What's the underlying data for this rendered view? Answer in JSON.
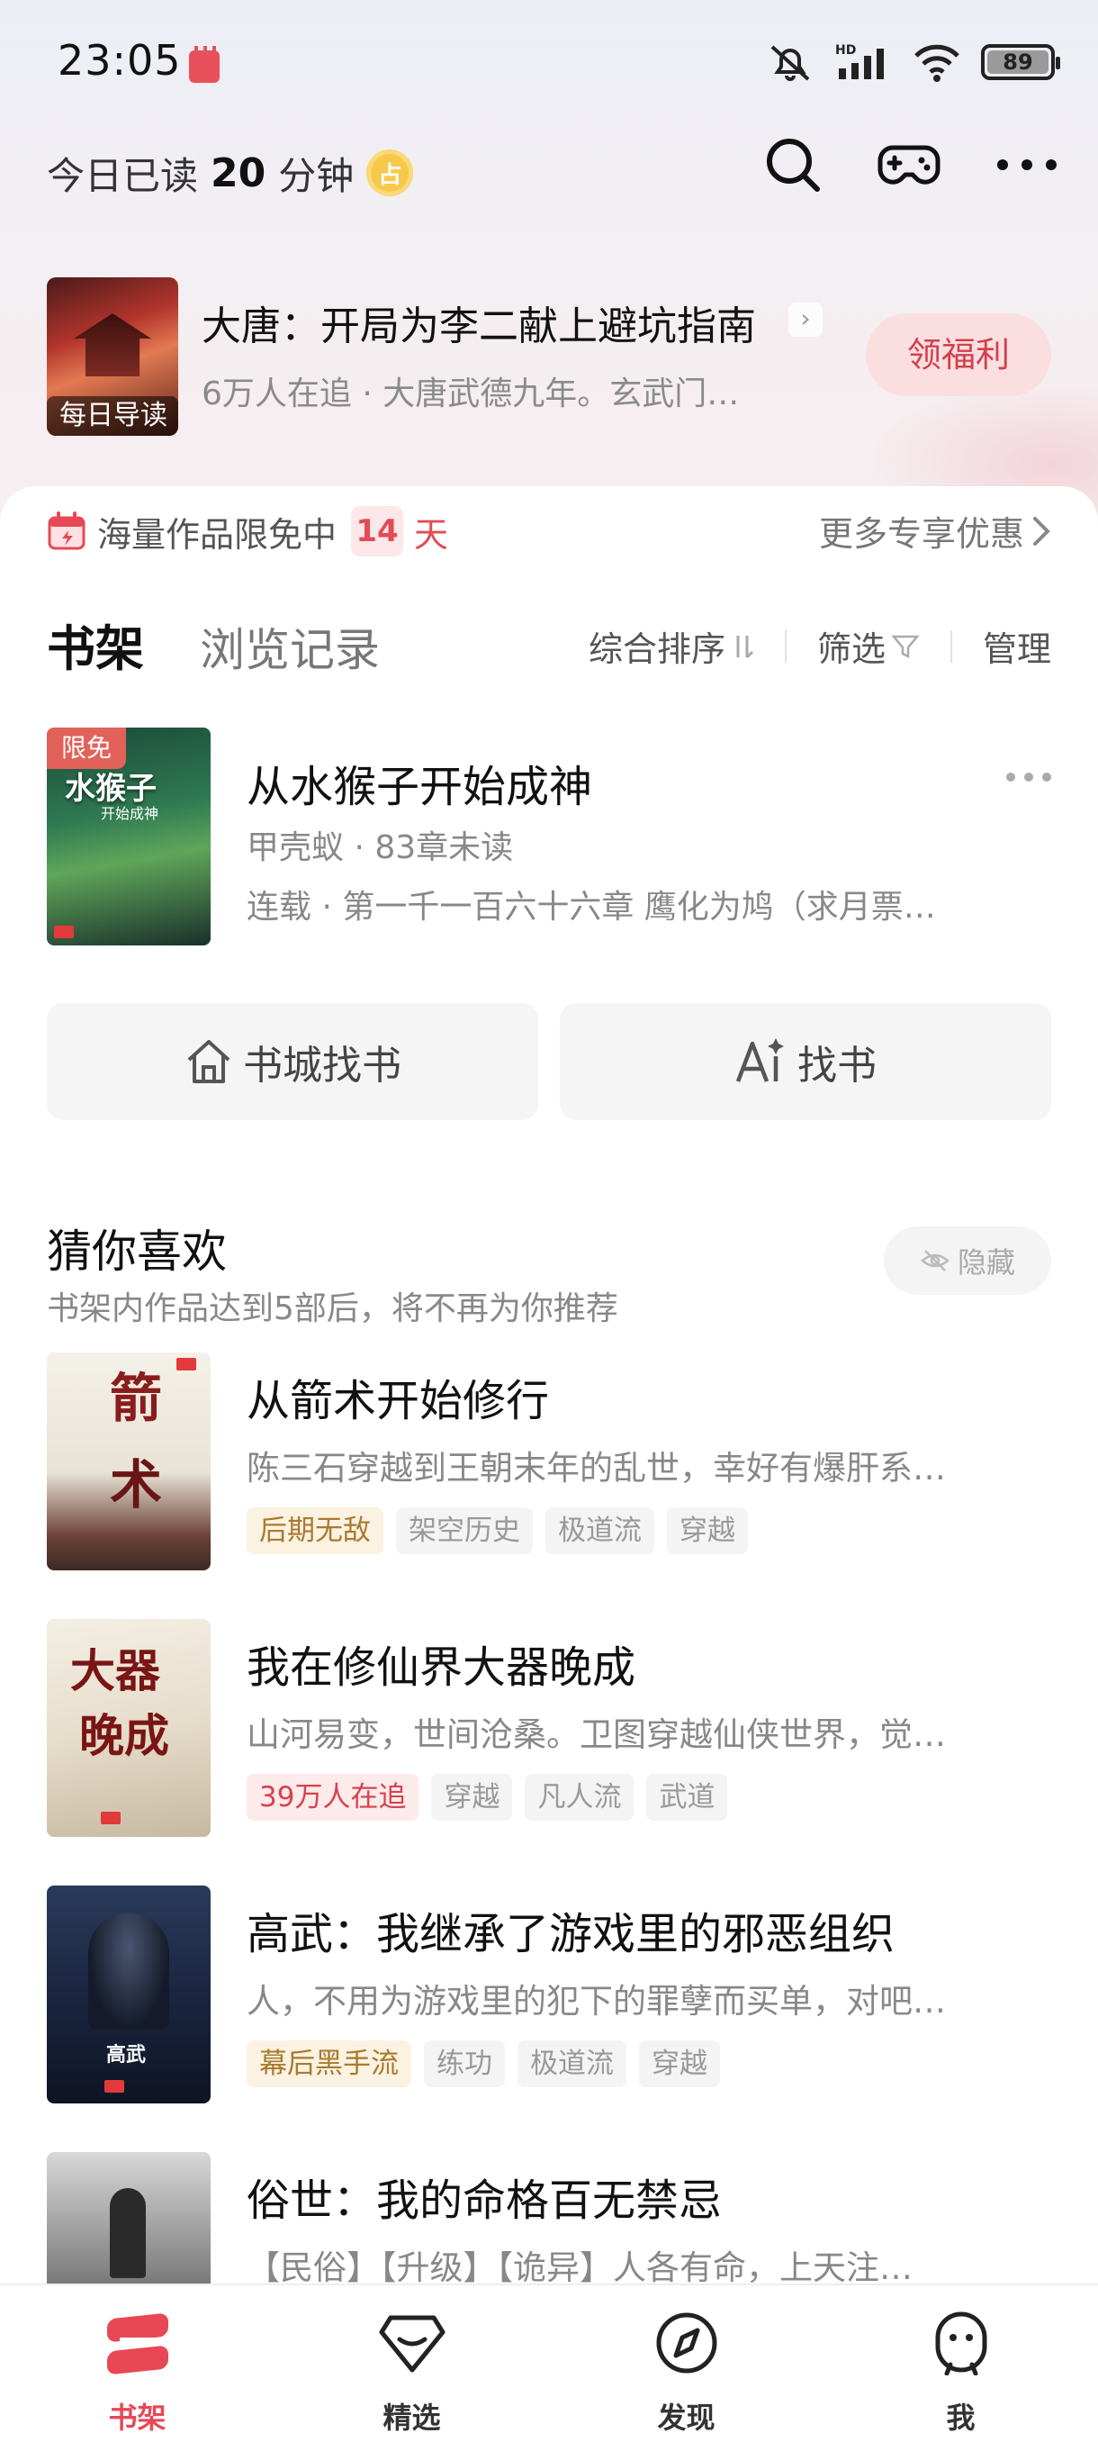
{
  "status_bar": {
    "time": "23:05",
    "battery": "89",
    "battery_level": 0.89,
    "signal_label": "HD"
  },
  "header": {
    "read_prefix": "今日已读",
    "read_minutes": "20",
    "read_unit": "分钟"
  },
  "daily_guide": {
    "cover_tag": "每日导读",
    "title": "大唐：开局为李二献上避坑指南",
    "subtitle": "6万人在追 · 大唐武德九年。玄武门…",
    "welfare_button": "领福利"
  },
  "promo": {
    "text": "海量作品限免中",
    "days": "14",
    "days_unit": "天",
    "more_deals": "更多专享优惠"
  },
  "tabs": {
    "shelf": "书架",
    "history": "浏览记录"
  },
  "sort_bar": {
    "sort": "综合排序",
    "filter": "筛选",
    "manage": "管理"
  },
  "shelf_books": [
    {
      "badge": "限免",
      "cover_title": "水猴子",
      "cover_subtitle": "开始成神",
      "title": "从水猴子开始成神",
      "author_progress": "甲壳蚁 · 83章未读",
      "latest": "连载 · 第一千一百六十六章 鹰化为鸠（求月票…"
    }
  ],
  "find_buttons": {
    "store": "书城找书",
    "ai": "找书"
  },
  "recommend": {
    "title": "猜你喜欢",
    "subtitle": "书架内作品达到5部后，将不再为你推荐",
    "hide_button": "隐藏",
    "items": [
      {
        "title": "从箭术开始修行",
        "desc": "陈三石穿越到王朝末年的乱世，幸好有爆肝系…",
        "tags": [
          "后期无敌",
          "架空历史",
          "极道流",
          "穿越"
        ]
      },
      {
        "title": "我在修仙界大器晚成",
        "desc": "山河易变，世间沧桑。卫图穿越仙侠世界，觉…",
        "tags": [
          "39万人在追",
          "穿越",
          "凡人流",
          "武道"
        ]
      },
      {
        "title": "高武：我继承了游戏里的邪恶组织",
        "desc": "人，不用为游戏里的犯下的罪孽而买单，对吧…",
        "tags": [
          "幕后黑手流",
          "练功",
          "极道流",
          "穿越"
        ]
      },
      {
        "title": "俗世：我的命格百无禁忌",
        "desc": "【民俗】【升级】【诡异】人各有命，上天注…",
        "tags": []
      }
    ]
  },
  "bottom_nav": [
    {
      "label": "书架"
    },
    {
      "label": "精选"
    },
    {
      "label": "发现"
    },
    {
      "label": "我"
    }
  ],
  "colors": {
    "accent": "#e84855",
    "gold_tag": "#a97a2e",
    "red_tag": "#d6424e"
  }
}
